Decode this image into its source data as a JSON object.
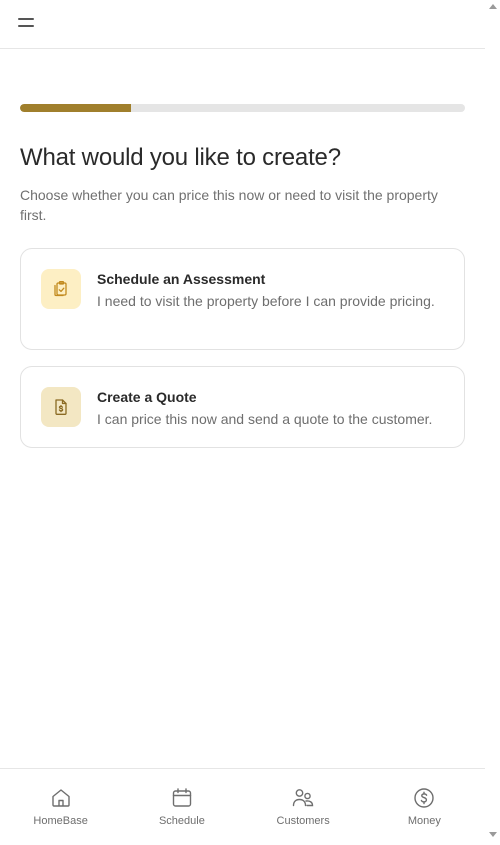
{
  "header": {
    "menu_icon": "hamburger-menu-icon"
  },
  "progress": {
    "value_fraction": 0.25,
    "fill_color": "#a07f2c",
    "track_color": "#e5e5e5"
  },
  "page": {
    "title": "What would you like to create?",
    "subtitle": "Choose whether you can price this now or need to visit the property first."
  },
  "options": [
    {
      "title": "Schedule an Assessment",
      "description": "I need to visit the property before I can provide pricing.",
      "icon": "clipboard-check-icon",
      "icon_bg": "#fdefc4"
    },
    {
      "title": "Create a Quote",
      "description": "I can price this now and send a quote to the customer.",
      "icon": "dollar-document-icon",
      "icon_bg": "#f3e7c3"
    }
  ],
  "nav": {
    "items": [
      {
        "label": "HomeBase",
        "icon": "home-icon"
      },
      {
        "label": "Schedule",
        "icon": "calendar-icon"
      },
      {
        "label": "Customers",
        "icon": "users-icon"
      },
      {
        "label": "Money",
        "icon": "dollar-circle-icon"
      }
    ]
  }
}
